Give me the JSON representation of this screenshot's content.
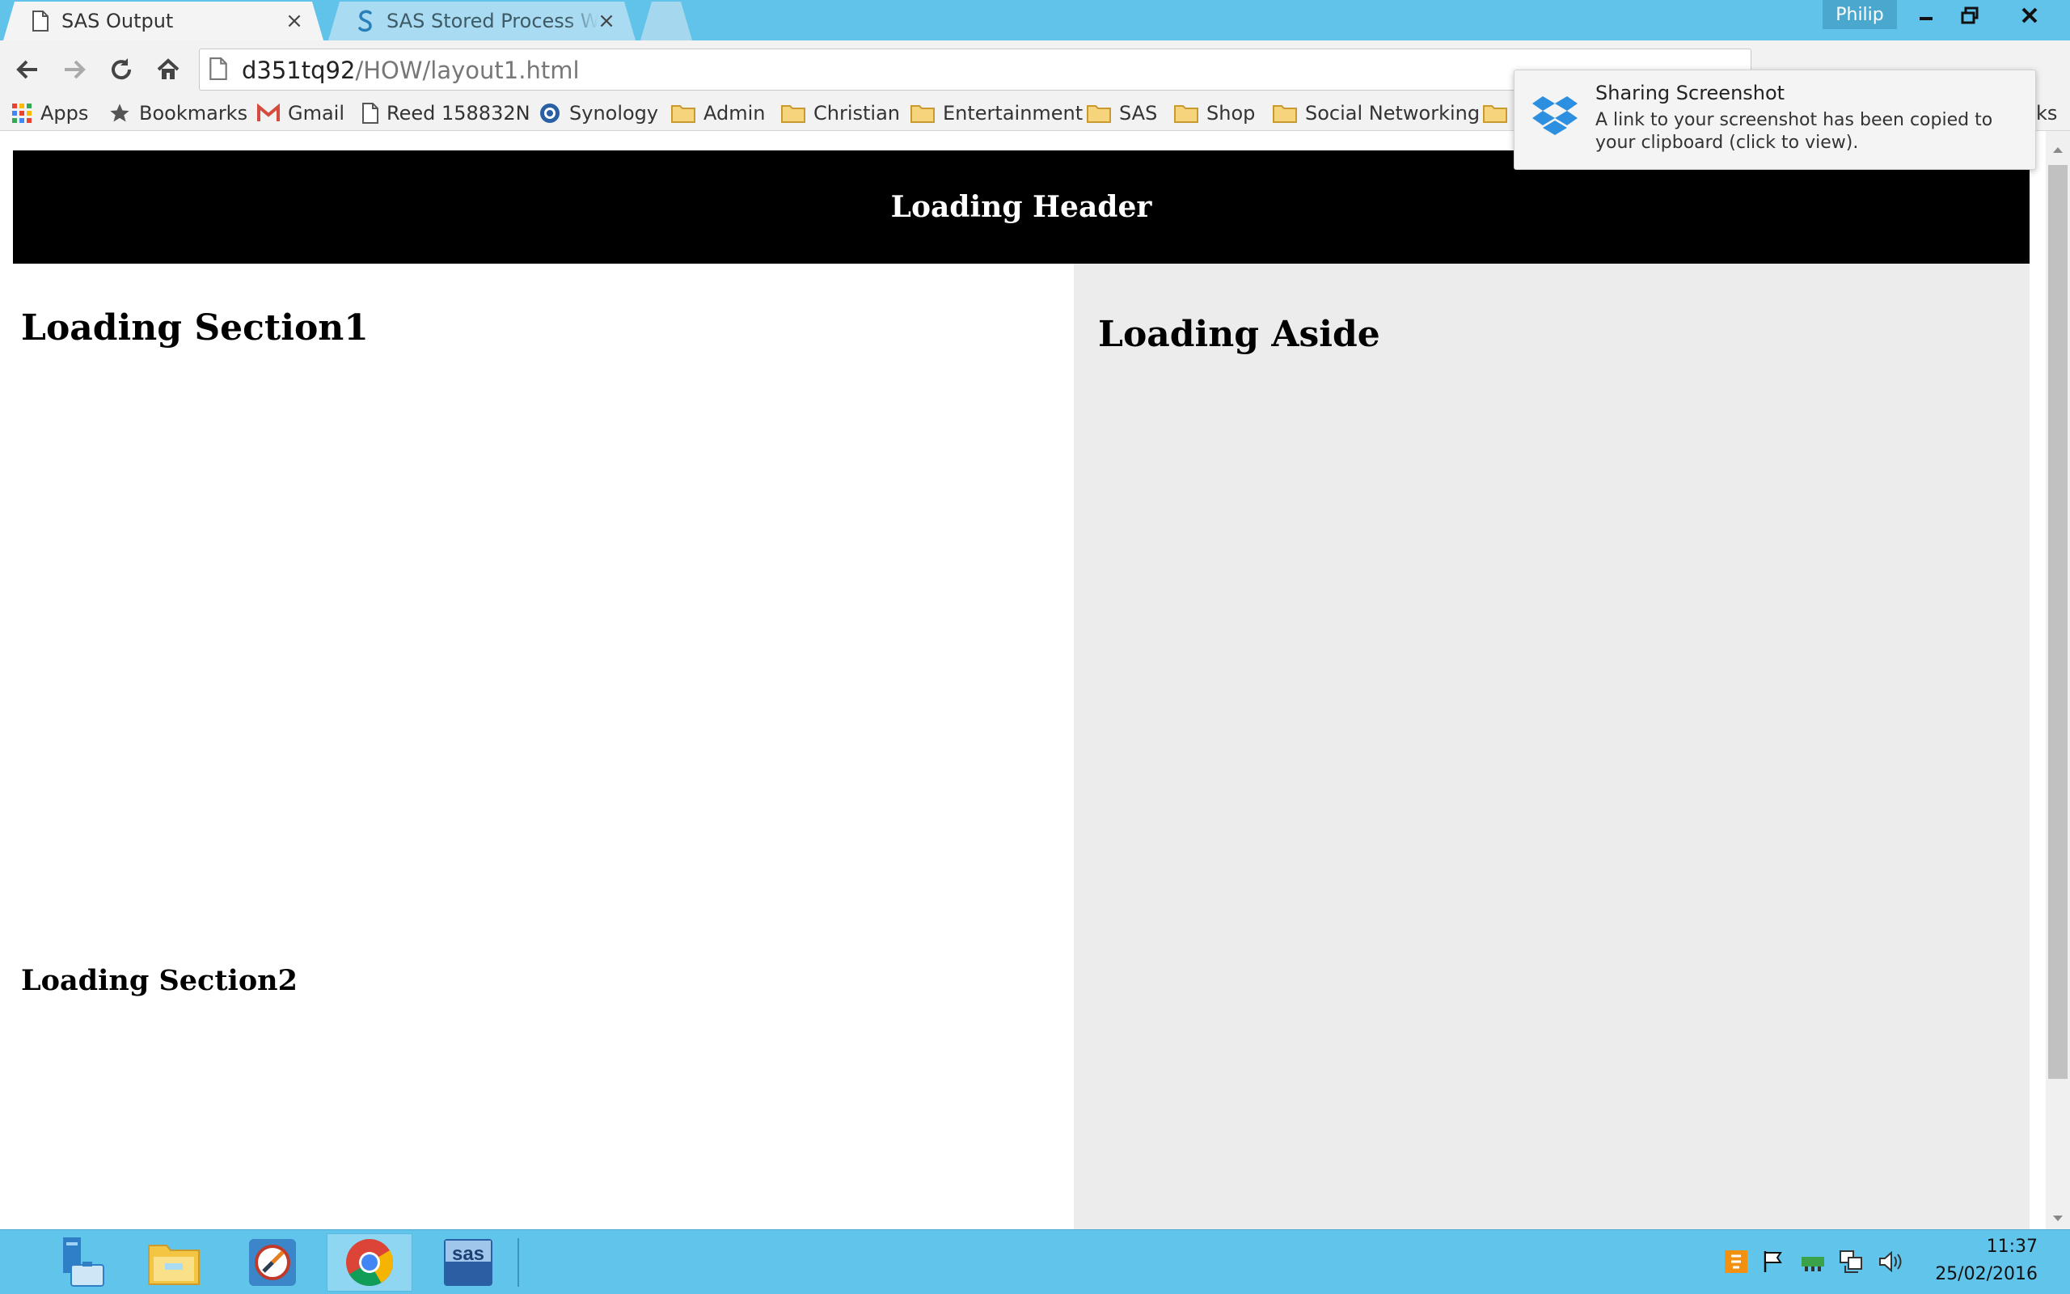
{
  "window": {
    "profile_name": "Philip",
    "colors": {
      "titlebar": "#62c3ea",
      "taskbar": "#61c4ea",
      "header_bg": "#000000",
      "aside_bg": "#ececec"
    }
  },
  "tabs": [
    {
      "title": "SAS Output",
      "icon": "page-icon",
      "active": true
    },
    {
      "title": "SAS Stored Process Web A",
      "icon": "sas-s-icon",
      "active": false
    }
  ],
  "address_bar": {
    "host": "d351tq92",
    "path": "/HOW/layout1.html"
  },
  "bookmarks": [
    {
      "label": "Apps",
      "icon": "apps-grid-icon"
    },
    {
      "label": "Bookmarks",
      "icon": "star-icon"
    },
    {
      "label": "Gmail",
      "icon": "gmail-icon"
    },
    {
      "label": "Reed 158832N",
      "icon": "page-icon"
    },
    {
      "label": "Synology",
      "icon": "synology-icon"
    },
    {
      "label": "Admin",
      "icon": "folder-icon"
    },
    {
      "label": "Christian",
      "icon": "folder-icon"
    },
    {
      "label": "Entertainment",
      "icon": "folder-icon"
    },
    {
      "label": "SAS",
      "icon": "folder-icon"
    },
    {
      "label": "Shop",
      "icon": "folder-icon"
    },
    {
      "label": "Social Networking",
      "icon": "folder-icon"
    },
    {
      "label": "",
      "icon": "folder-icon"
    },
    {
      "label": "ks",
      "icon": ""
    }
  ],
  "notification": {
    "title": "Sharing Screenshot",
    "body": "A link to your screenshot has been copied to your clipboard (click to view)."
  },
  "page": {
    "header": "Loading Header",
    "section1": "Loading Section1",
    "section2": "Loading Section2",
    "aside": "Loading Aside"
  },
  "taskbar": {
    "apps": [
      "server-manager-icon",
      "file-explorer-icon",
      "sas-enterprise-guide-icon",
      "chrome-icon",
      "sas-icon"
    ],
    "active_app": "chrome-icon",
    "clock": {
      "time": "11:37",
      "date": "25/02/2016"
    }
  }
}
